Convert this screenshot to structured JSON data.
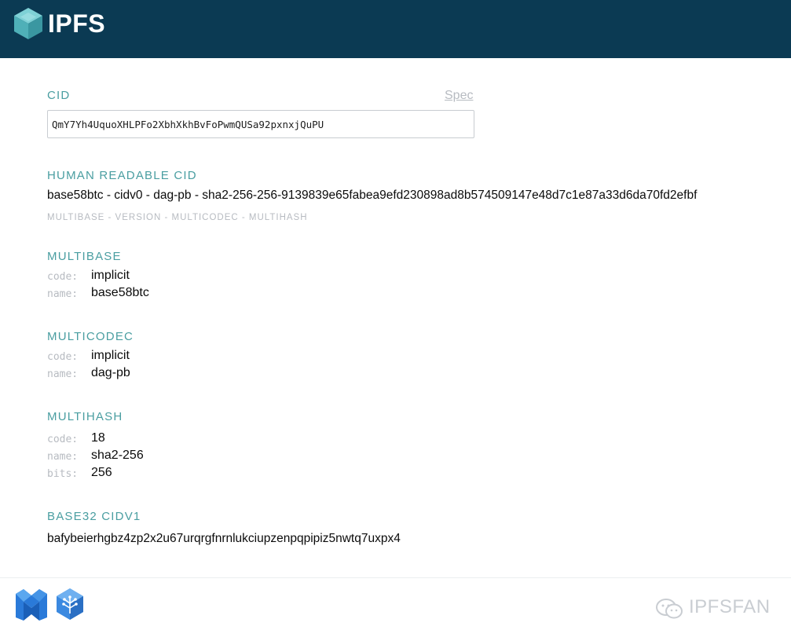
{
  "header": {
    "brand": "IPFS"
  },
  "cid": {
    "label": "CID",
    "spec_link": "Spec",
    "value": "QmY7Yh4UquoXHLPFo2XbhXkhBvFoPwmQUSa92pxnxjQuPU"
  },
  "human_readable": {
    "label": "HUMAN READABLE CID",
    "value": "base58btc - cidv0 - dag-pb - sha2-256-256-9139839e65fabea9efd230898ad8b574509147e48d7c1e87a33d6da70fd2efbf",
    "caption": "MULTIBASE - VERSION - MULTICODEC - MULTIHASH"
  },
  "multibase": {
    "label": "MULTIBASE",
    "code_key": "code:",
    "code": "implicit",
    "name_key": "name:",
    "name": "base58btc"
  },
  "multicodec": {
    "label": "MULTICODEC",
    "code_key": "code:",
    "code": "implicit",
    "name_key": "name:",
    "name": "dag-pb"
  },
  "multihash": {
    "label": "MULTIHASH",
    "code_key": "code:",
    "code": "18",
    "name_key": "name:",
    "name": "sha2-256",
    "bits_key": "bits:",
    "bits": "256"
  },
  "base32": {
    "label": "BASE32 CIDV1",
    "value": "bafybeierhgbz4zp2x2u67urqrgfnrnlukciupzenpqpipiz5nwtq7uxpx4"
  },
  "watermark": {
    "text": "IPFSFAN"
  },
  "colors": {
    "header_bg": "#0b3a53",
    "accent": "#4a9ea1",
    "muted": "#b7bbc1"
  }
}
